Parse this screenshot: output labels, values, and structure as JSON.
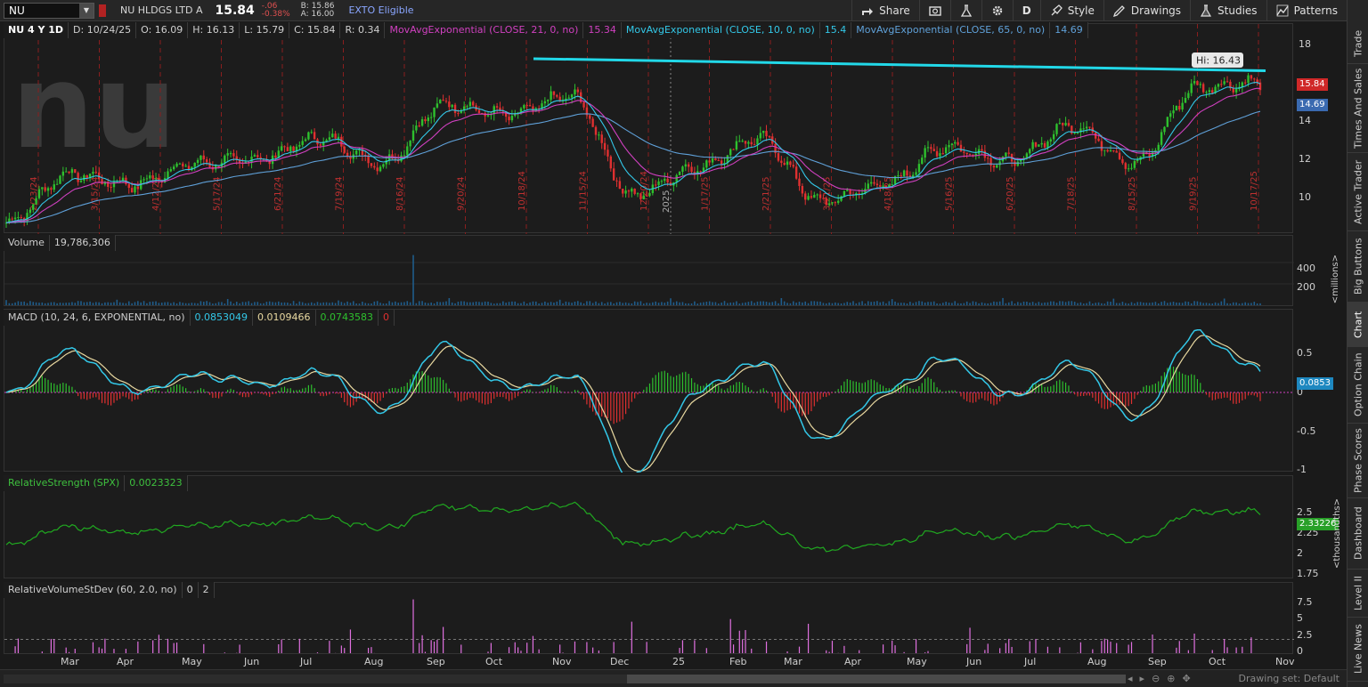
{
  "header": {
    "symbol": "NU",
    "company": "NU HLDGS LTD A",
    "last": "15.84",
    "change": "-.06",
    "change_pct": "-0.38%",
    "bid": "B: 15.86",
    "ask": "A: 16.00",
    "exto": "EXTO Eligible",
    "buttons": {
      "share": "Share",
      "period": "D",
      "style": "Style",
      "drawings": "Drawings",
      "studies": "Studies",
      "patterns": "Patterns"
    }
  },
  "price_panel": {
    "chart_id": "NU 4 Y 1D",
    "date": "D: 10/24/25",
    "open": "O: 16.09",
    "high": "H: 16.13",
    "low": "L: 15.79",
    "close": "C: 15.84",
    "range": "R: 0.34",
    "ma1_label": "MovAvgExponential (CLOSE, 21, 0, no)",
    "ma1_value": "15.34",
    "ma2_label": "MovAvgExponential (CLOSE, 10, 0, no)",
    "ma2_value": "15.4",
    "ma3_label": "MovAvgExponential (CLOSE, 65, 0, no)",
    "ma3_value": "14.69",
    "hi_label": "Hi: 16.43",
    "last_flag": "15.84",
    "ma3_flag": "14.69",
    "ticks": [
      "18",
      "16",
      "14",
      "12",
      "10"
    ],
    "event_dates": [
      "2/23/24",
      "3/15/24",
      "4/12/24",
      "5/17/24",
      "6/21/24",
      "7/19/24",
      "8/16/24",
      "9/20/24",
      "10/18/24",
      "11/15/24",
      "12/20/24",
      "1/17/25",
      "2/21/25",
      "3/21/25",
      "4/18/25",
      "5/16/25",
      "6/20/25",
      "7/18/25",
      "8/15/25",
      "9/19/25",
      "10/17/25"
    ],
    "year_marker": "2025"
  },
  "volume_panel": {
    "label": "Volume",
    "value": "19,786,306",
    "ticks": [
      "400",
      "200"
    ],
    "unit": "<millions>"
  },
  "macd_panel": {
    "label": "MACD (10, 24, 6, EXPONENTIAL, no)",
    "v1": "0.0853049",
    "v2": "0.0109466",
    "v3": "0.0743583",
    "v4": "0",
    "flag": "0.0853",
    "ticks": [
      "0.5",
      "0",
      "-0.5",
      "-1"
    ]
  },
  "rs_panel": {
    "label": "RelativeStrength (SPX)",
    "value": "0.0023323",
    "flag": "2.33226",
    "ticks": [
      "2.5",
      "2.25",
      "2",
      "1.75"
    ],
    "unit": "<thousandths>"
  },
  "rvsd_panel": {
    "label": "RelativeVolumeStDev (60, 2.0, no)",
    "v1": "0",
    "v2": "2",
    "ticks": [
      "7.5",
      "5",
      "2.5",
      "0"
    ]
  },
  "x_axis": {
    "months": [
      "Mar",
      "Apr",
      "May",
      "Jun",
      "Jul",
      "Aug",
      "Sep",
      "Oct",
      "Nov",
      "Dec",
      "25",
      "Feb",
      "Mar",
      "Apr",
      "May",
      "Jun",
      "Jul",
      "Aug",
      "Sep",
      "Oct",
      "Nov"
    ]
  },
  "right_sidebar": {
    "tabs": [
      "Trade",
      "Times And Sales",
      "Active Trader",
      "Big Buttons",
      "Chart",
      "Option Chain",
      "Phase Scores",
      "Dashboard",
      "Level II",
      "Live News"
    ],
    "active": "Chart"
  },
  "bottom": {
    "drawing_set": "Drawing set: Default"
  },
  "colors": {
    "up": "#2ec02e",
    "down": "#e03030",
    "ema10": "#33c8e8",
    "ema21": "#d040c0",
    "ema65": "#5fa0d8",
    "trendline": "#22d8e8",
    "macd": "#33c8e8",
    "signal": "#e8d8a0",
    "rs": "#20a820",
    "rvsd": "#e070e0"
  },
  "chart_data": [
    {
      "type": "line",
      "title": "NU 4 Y 1D",
      "x": [
        "Feb 2024",
        "Mar 2024",
        "Apr 2024",
        "May 2024",
        "Jun 2024",
        "Jul 2024",
        "Aug 2024",
        "Sep 2024",
        "Oct 2024",
        "Nov 2024",
        "Dec 2024",
        "Jan 2025",
        "Feb 2025",
        "Mar 2025",
        "Apr 2025",
        "May 2025",
        "Jun 2025",
        "Jul 2025",
        "Aug 2025",
        "Sep 2025",
        "Oct 2025"
      ],
      "series": [
        {
          "name": "NU",
          "values": [
            9.2,
            11.5,
            11.0,
            12.0,
            12.2,
            13.2,
            12.0,
            14.8,
            14.3,
            15.2,
            10.5,
            11.8,
            13.2,
            10.2,
            11.0,
            12.8,
            12.1,
            13.8,
            12.0,
            15.6,
            15.84
          ]
        }
      ],
      "ylim": [
        9,
        18
      ],
      "high_marker": 16.43
    },
    {
      "type": "bar",
      "title": "Volume",
      "spike": {
        "x": "Aug 2024",
        "value": 470
      },
      "ylim": [
        0,
        500
      ]
    }
  ]
}
